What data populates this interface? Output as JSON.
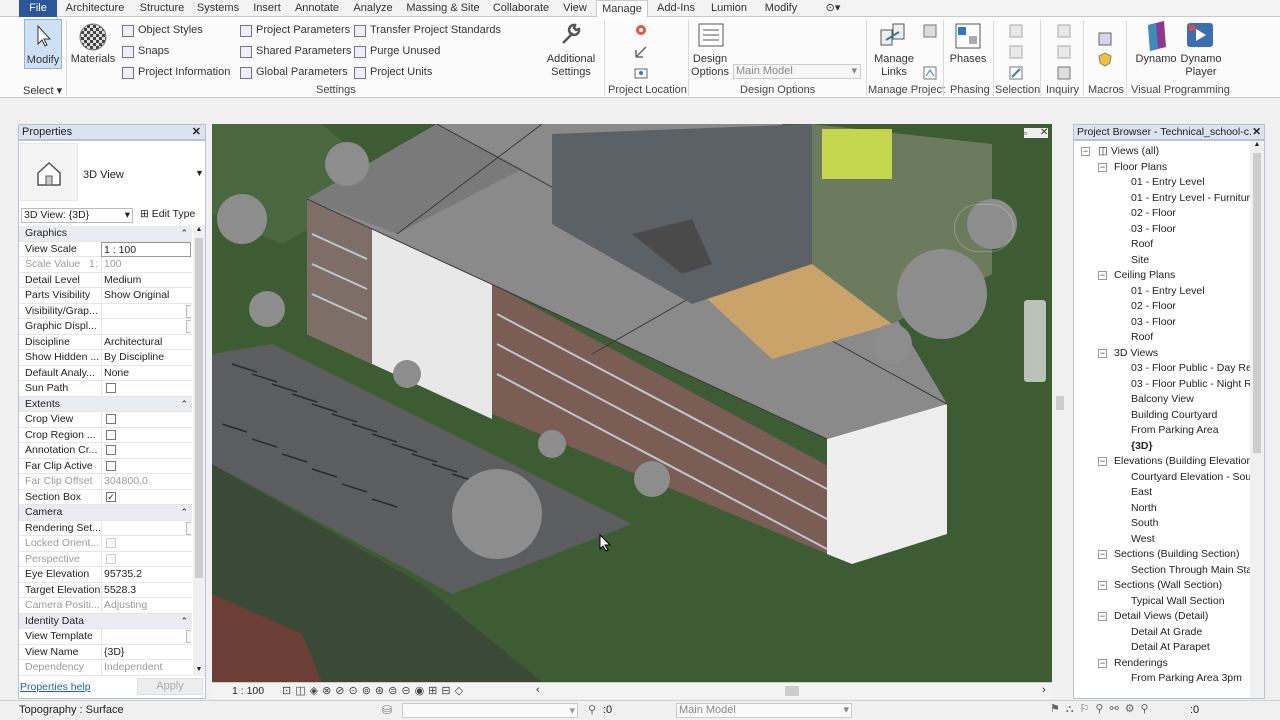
{
  "menu": {
    "tabs": [
      "File",
      "Architecture",
      "Structure",
      "Systems",
      "Insert",
      "Annotate",
      "Analyze",
      "Massing & Site",
      "Collaborate",
      "View",
      "Manage",
      "Add-Ins",
      "Lumion",
      "Modify"
    ],
    "active": "Manage"
  },
  "ribbon": {
    "modify": "Modify",
    "select": "Select",
    "materials": "Materials",
    "settings_items": [
      "Object Styles",
      "Snaps",
      "Project Information",
      "Project Parameters",
      "Shared Parameters",
      "Global Parameters",
      "Transfer Project Standards",
      "Purge Unused",
      "Project Units"
    ],
    "additional_settings": "Additional Settings",
    "panel_settings": "Settings",
    "panel_location": "Project Location",
    "design_options": "Design Options",
    "main_model": "Main Model",
    "panel_design_options": "Design Options",
    "manage_links": "Manage Links",
    "panel_manage_project": "Manage Project",
    "phases": "Phases",
    "panel_phasing": "Phasing",
    "panel_selection": "Selection",
    "panel_inquiry": "Inquiry",
    "panel_macros": "Macros",
    "dynamo": "Dynamo",
    "dynamo_player": "Dynamo Player",
    "panel_visual_programming": "Visual Programming"
  },
  "properties": {
    "title": "Properties",
    "type_name": "3D View",
    "selector": "3D View: {3D}",
    "edit_type": "Edit Type",
    "rows": [
      {
        "k": "Graphics",
        "group": true
      },
      {
        "k": "View Scale",
        "v": "1 : 100"
      },
      {
        "k": "Scale Value",
        "v": "100",
        "dis": true,
        "extra": "1:"
      },
      {
        "k": "Detail Level",
        "v": "Medium"
      },
      {
        "k": "Parts Visibility",
        "v": "Show Original"
      },
      {
        "k": "Visibility/Grap...",
        "btn": "Edit..."
      },
      {
        "k": "Graphic Displ...",
        "btn": "Edit..."
      },
      {
        "k": "Discipline",
        "v": "Architectural"
      },
      {
        "k": "Show Hidden ...",
        "v": "By Discipline"
      },
      {
        "k": "Default Analy...",
        "v": "None"
      },
      {
        "k": "Sun Path",
        "chk": false
      },
      {
        "k": "Extents",
        "group": true
      },
      {
        "k": "Crop View",
        "chk": false
      },
      {
        "k": "Crop Region ...",
        "chk": false
      },
      {
        "k": "Annotation Cr...",
        "chk": false
      },
      {
        "k": "Far Clip Active",
        "chk": false
      },
      {
        "k": "Far Clip Offset",
        "v": "304800.0",
        "dis": true
      },
      {
        "k": "Section Box",
        "chk": true
      },
      {
        "k": "Camera",
        "group": true
      },
      {
        "k": "Rendering Set...",
        "btn": "Edit..."
      },
      {
        "k": "Locked Orient...",
        "chk": false,
        "dis": true
      },
      {
        "k": "Perspective",
        "chk": false,
        "dis": true
      },
      {
        "k": "Eye Elevation",
        "v": "95735.2"
      },
      {
        "k": "Target Elevation",
        "v": "5528.3"
      },
      {
        "k": "Camera Positi...",
        "v": "Adjusting",
        "dis": true
      },
      {
        "k": "Identity Data",
        "group": true
      },
      {
        "k": "View Template",
        "btn": "<None>"
      },
      {
        "k": "View Name",
        "v": "{3D}"
      },
      {
        "k": "Dependency",
        "v": "Independent",
        "dis": true
      }
    ],
    "help": "Properties help",
    "apply": "Apply"
  },
  "browser": {
    "title": "Project Browser - Technical_school-c...",
    "nodes": [
      {
        "t": "Views (all)",
        "lvl": 0,
        "tog": "-"
      },
      {
        "t": "Floor Plans",
        "lvl": 1,
        "tog": "-"
      },
      {
        "t": "01 - Entry Level",
        "lvl": 2
      },
      {
        "t": "01 - Entry Level - Furnitur",
        "lvl": 2
      },
      {
        "t": "02 - Floor",
        "lvl": 2
      },
      {
        "t": "03 - Floor",
        "lvl": 2
      },
      {
        "t": "Roof",
        "lvl": 2
      },
      {
        "t": "Site",
        "lvl": 2
      },
      {
        "t": "Ceiling Plans",
        "lvl": 1,
        "tog": "-"
      },
      {
        "t": "01 - Entry Level",
        "lvl": 2
      },
      {
        "t": "02 - Floor",
        "lvl": 2
      },
      {
        "t": "03 - Floor",
        "lvl": 2
      },
      {
        "t": "Roof",
        "lvl": 2
      },
      {
        "t": "3D Views",
        "lvl": 1,
        "tog": "-"
      },
      {
        "t": "03 - Floor Public - Day Re",
        "lvl": 2
      },
      {
        "t": "03 - Floor Public - Night R",
        "lvl": 2
      },
      {
        "t": "Balcony View",
        "lvl": 2
      },
      {
        "t": "Building Courtyard",
        "lvl": 2
      },
      {
        "t": "From Parking Area",
        "lvl": 2
      },
      {
        "t": "{3D}",
        "lvl": 2,
        "bold": true
      },
      {
        "t": "Elevations (Building Elevation",
        "lvl": 1,
        "tog": "-"
      },
      {
        "t": "Courtyard Elevation - Sou",
        "lvl": 2
      },
      {
        "t": "East",
        "lvl": 2
      },
      {
        "t": "North",
        "lvl": 2
      },
      {
        "t": "South",
        "lvl": 2
      },
      {
        "t": "West",
        "lvl": 2
      },
      {
        "t": "Sections (Building Section)",
        "lvl": 1,
        "tog": "-"
      },
      {
        "t": "Section Through Main Sta",
        "lvl": 2
      },
      {
        "t": "Sections (Wall Section)",
        "lvl": 1,
        "tog": "-"
      },
      {
        "t": "Typical Wall Section",
        "lvl": 2
      },
      {
        "t": "Detail Views (Detail)",
        "lvl": 1,
        "tog": "-"
      },
      {
        "t": "Detail At Grade",
        "lvl": 2
      },
      {
        "t": "Detail At Parapet",
        "lvl": 2
      },
      {
        "t": "Renderings",
        "lvl": 1,
        "tog": "-"
      },
      {
        "t": "From Parking Area 3pm",
        "lvl": 2
      }
    ]
  },
  "viewbar": {
    "scale": "1 : 100"
  },
  "status": {
    "text": "Topography : Surface",
    "count": ":0",
    "model": "Main Model",
    "count2": ":0"
  }
}
